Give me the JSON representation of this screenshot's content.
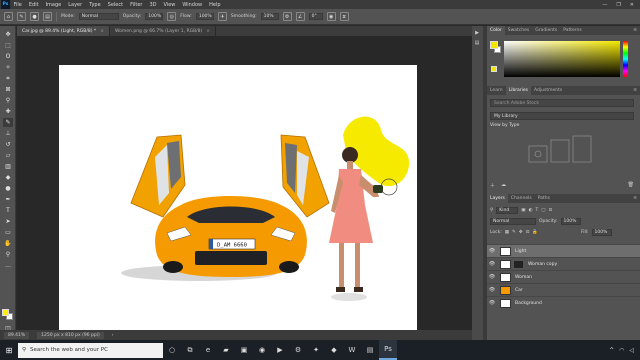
{
  "menubar": {
    "app_badge": "Ps",
    "items": [
      "File",
      "Edit",
      "Image",
      "Layer",
      "Type",
      "Select",
      "Filter",
      "3D",
      "View",
      "Window",
      "Help"
    ],
    "controls": [
      "—",
      "❐",
      "✕"
    ]
  },
  "options": {
    "mode_label": "Mode:",
    "mode_value": "Normal",
    "opacity_label": "Opacity:",
    "opacity_value": "100%",
    "flow_label": "Flow:",
    "flow_value": "100%",
    "smoothing_label": "Smoothing:",
    "smoothing_value": "10%",
    "angle_value": "0°"
  },
  "documents": {
    "tabs": [
      {
        "label": "Car.jpg @ 89.4% (Light, RGB/8) *",
        "active": true
      },
      {
        "label": "Women.png @ 66.7% (Layer 1, RGB/8)",
        "active": false
      }
    ],
    "plate_text": "D_AM 6660"
  },
  "status": {
    "zoom": "89.41%",
    "doc_info": "1250 px x 810 px (96 ppi)"
  },
  "color_panel": {
    "tabs": [
      "Color",
      "Swatches",
      "Gradients",
      "Patterns"
    ]
  },
  "libraries_panel": {
    "tabs": [
      "Learn",
      "Libraries",
      "Adjustments"
    ],
    "active_tab": "Libraries",
    "search_placeholder": "Search Adobe Stock",
    "library_name": "My Library",
    "view_label": "View by Type"
  },
  "layers_panel": {
    "tabs": [
      "Layers",
      "Channels",
      "Paths"
    ],
    "kind_label": "Kind",
    "blend_mode": "Normal",
    "opacity_label": "Opacity:",
    "opacity_value": "100%",
    "lock_label": "Lock:",
    "fill_label": "Fill:",
    "fill_value": "100%",
    "layers": [
      {
        "name": "Light",
        "selected": true
      },
      {
        "name": "Woman copy",
        "selected": false
      },
      {
        "name": "Woman",
        "selected": false
      },
      {
        "name": "Car",
        "selected": false
      },
      {
        "name": "Background",
        "selected": false
      }
    ]
  },
  "taskbar": {
    "search_placeholder": "Search the web and your PC"
  },
  "colors": {
    "accent_yellow": "#ffee00",
    "car_orange": "#f59a00",
    "panel_bg": "#535353",
    "selected_layer": "#6e6e6e"
  }
}
